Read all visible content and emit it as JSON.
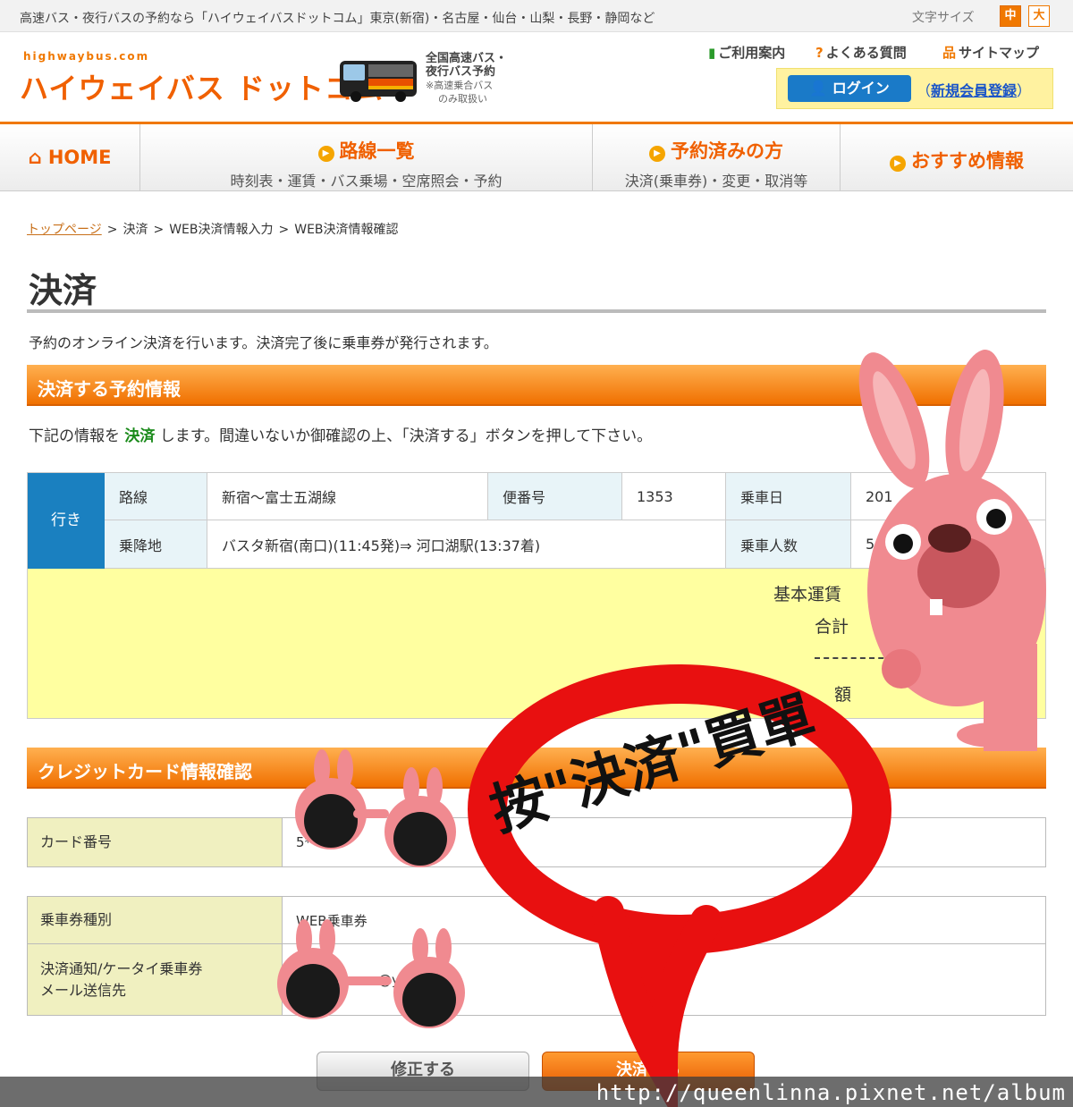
{
  "topbar": {
    "tagline": "高速バス・夜行バスの予約なら「ハイウェイバスドットコム」東京(新宿)・名古屋・仙台・山梨・長野・静岡など",
    "font_size_label": "文字サイズ",
    "font_mid": "中",
    "font_big": "大"
  },
  "header": {
    "logo_small": "highwaybus.com",
    "logo_main": "ハイウェイバス ドットコム",
    "sub_line1": "全国高速バス・",
    "sub_line2": "夜行バス予約",
    "sub_line3": "※高速乗合バス",
    "sub_line4": "のみ取扱い",
    "util_guide": "ご利用案内",
    "util_faq": "よくある質問",
    "util_sitemap": "サイトマップ",
    "login": "ログイン",
    "register_open": "（",
    "register": "新規会員登録",
    "register_close": "）"
  },
  "nav": {
    "home": "HOME",
    "routes_title": "路線一覧",
    "routes_sub": "時刻表・運賃・バス乗場・空席照会・予約",
    "booked_title": "予約済みの方",
    "booked_sub": "決済(乗車券)・変更・取消等",
    "recommend_title": "おすすめ情報"
  },
  "breadcrumb": {
    "top": "トップページ",
    "sep": ">",
    "step1": "決済",
    "step2": "WEB決済情報入力",
    "step3": "WEB決済情報確認"
  },
  "page": {
    "title": "決済",
    "intro": "予約のオンライン決済を行います。決済完了後に乗車券が発行されます。",
    "section1": "決済する予約情報",
    "note_before": "下記の情報を ",
    "note_highlight": "決済",
    "note_after": " します。間違いないか御確認の上、「決済する」ボタンを押して下さい。",
    "section2": "クレジットカード情報確認"
  },
  "reservation": {
    "direction": "行き",
    "route_label": "路線",
    "route_value": "新宿～富士五湖線",
    "flight_label": "便番号",
    "flight_value": "1353",
    "date_label": "乗車日",
    "date_value": "201",
    "stop_label": "乗降地",
    "stop_value": "バスタ新宿(南口)(11:45発)⇒ 河口湖駅(13:37着)",
    "pax_label": "乗車人数",
    "pax_value": "5",
    "base_fare": "基本運賃",
    "total": "合計",
    "amount_partial": "額"
  },
  "card": {
    "number_label": "カード番号",
    "number_value": "5*****"
  },
  "ticket": {
    "type_label": "乗車券種別",
    "type_value": "WEB乗車券",
    "mail_label_line1": "決済通知/ケータイ乗車券",
    "mail_label_line2": "メール送信先",
    "mail_value": "@y"
  },
  "buttons": {
    "fix": "修正する",
    "pay": "決済する"
  },
  "annotation": {
    "text": "按\"決済\"買單",
    "watermark": "http://queenlinna.pixnet.net/album"
  },
  "colors": {
    "accent": "#f07800",
    "blue": "#1a80c0",
    "annotation_red": "#e81010"
  }
}
